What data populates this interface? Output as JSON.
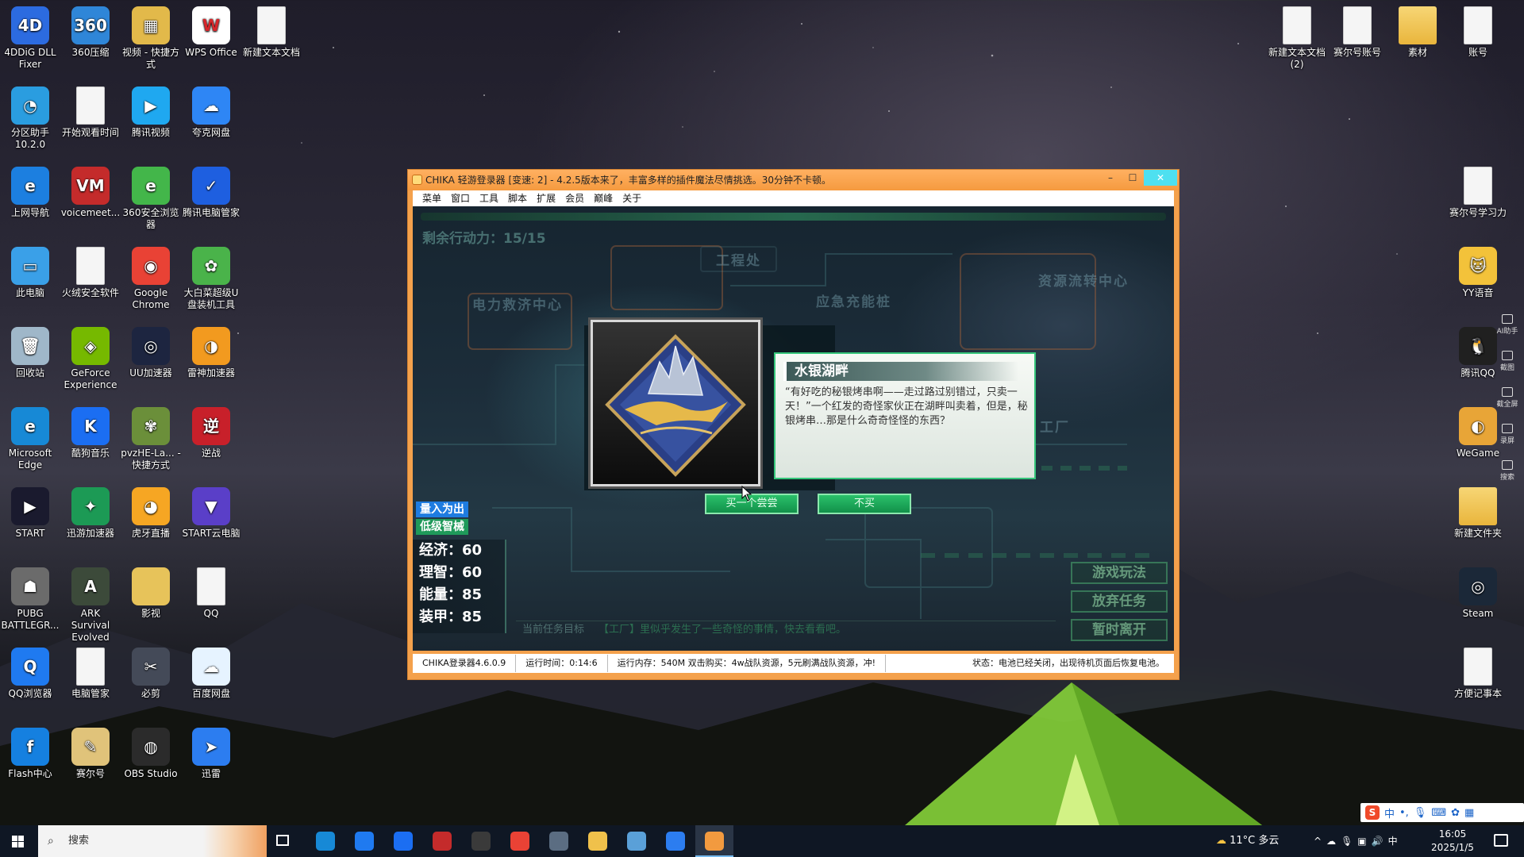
{
  "desktop": {
    "icons_left": [
      {
        "label": "4DDiG DLL Fixer",
        "color": "#2c6be0",
        "glyph": "4D"
      },
      {
        "label": "360压缩",
        "color": "#2f86d8",
        "glyph": "360"
      },
      {
        "label": "视频 - 快捷方式",
        "color": "#e2b94a",
        "glyph": "▦"
      },
      {
        "label": "WPS Office",
        "color": "#ffffff",
        "glyph": "W"
      },
      {
        "label": "新建文本文档",
        "color": "#f5f5f5",
        "glyph": ""
      },
      {
        "label": "分区助手 10.2.0",
        "color": "#2a9de0",
        "glyph": "◔"
      },
      {
        "label": "开始观看时间",
        "color": "#f5f5f5",
        "glyph": ""
      },
      {
        "label": "腾讯视频",
        "color": "#1fa8f0",
        "glyph": "▶"
      },
      {
        "label": "夸克网盘",
        "color": "#2e86f5",
        "glyph": "☁"
      },
      {
        "label": "上网导航",
        "color": "#1c7fe0",
        "glyph": "e"
      },
      {
        "label": "voicemeet...",
        "color": "#c42b2b",
        "glyph": "VM"
      },
      {
        "label": "360安全浏览器",
        "color": "#43b64a",
        "glyph": "e"
      },
      {
        "label": "腾讯电脑管家",
        "color": "#1e5fe0",
        "glyph": "✓"
      },
      {
        "label": "此电脑",
        "color": "#3aa0e8",
        "glyph": "▭"
      },
      {
        "label": "火绒安全软件",
        "color": "#f5f5f5",
        "glyph": ""
      },
      {
        "label": "Google Chrome",
        "color": "#e94235",
        "glyph": "◉"
      },
      {
        "label": "大白菜超级U盘装机工具",
        "color": "#4ab34a",
        "glyph": "✿"
      },
      {
        "label": "回收站",
        "color": "#9fb7c9",
        "glyph": "🗑"
      },
      {
        "label": "GeForce Experience",
        "color": "#76b900",
        "glyph": "◈"
      },
      {
        "label": "UU加速器",
        "color": "#1d2540",
        "glyph": "◎"
      },
      {
        "label": "雷神加速器",
        "color": "#f29a1f",
        "glyph": "◑"
      },
      {
        "label": "Microsoft Edge",
        "color": "#1789d6",
        "glyph": "e"
      },
      {
        "label": "酷狗音乐",
        "color": "#1b6ef2",
        "glyph": "K"
      },
      {
        "label": "pvzHE-La... - 快捷方式",
        "color": "#6b8f3a",
        "glyph": "✾"
      },
      {
        "label": "逆战",
        "color": "#c8202a",
        "glyph": "逆"
      },
      {
        "label": "START",
        "color": "#1a1a2e",
        "glyph": "▶"
      },
      {
        "label": "迅游加速器",
        "color": "#1c9a55",
        "glyph": "✦"
      },
      {
        "label": "虎牙直播",
        "color": "#f6a623",
        "glyph": "◕"
      },
      {
        "label": "START云电脑",
        "color": "#5a3fc8",
        "glyph": "▼"
      },
      {
        "label": "PUBG BATTLEGR...",
        "color": "#6b6b6b",
        "glyph": "☗"
      },
      {
        "label": "ARK Survival Evolved",
        "color": "#3c4a3a",
        "glyph": "A"
      },
      {
        "label": "影视",
        "color": "#e7c35a",
        "glyph": ""
      },
      {
        "label": "QQ",
        "color": "#f5f5f5",
        "glyph": "🐧"
      },
      {
        "label": "QQ浏览器",
        "color": "#1f7af0",
        "glyph": "Q"
      },
      {
        "label": "电脑管家",
        "color": "#f5f5f5",
        "glyph": ""
      },
      {
        "label": "必剪",
        "color": "#444a58",
        "glyph": "✂"
      },
      {
        "label": "百度网盘",
        "color": "#e6f3ff",
        "glyph": "☁"
      },
      {
        "label": "Flash中心",
        "color": "#1580e0",
        "glyph": "f"
      },
      {
        "label": "赛尔号",
        "color": "#e0c37a",
        "glyph": "✎"
      },
      {
        "label": "OBS Studio",
        "color": "#2b2b2b",
        "glyph": "◍"
      },
      {
        "label": "迅雷",
        "color": "#2c7df0",
        "glyph": "➤"
      }
    ],
    "icons_right": [
      {
        "label": "新建文本文档 (2)",
        "kind": "doc"
      },
      {
        "label": "赛尔号账号",
        "kind": "doc"
      },
      {
        "label": "素材",
        "kind": "folder"
      },
      {
        "label": "账号",
        "kind": "doc"
      },
      {
        "label": "赛尔号学习力",
        "kind": "doc"
      },
      {
        "label": "YY语音",
        "kind": "app",
        "color": "#f3c23a",
        "glyph": "🐱"
      },
      {
        "label": "腾讯QQ",
        "kind": "app",
        "color": "#202020",
        "glyph": "🐧"
      },
      {
        "label": "WeGame",
        "kind": "app",
        "color": "#e8a537",
        "glyph": "◐"
      },
      {
        "label": "新建文件夹",
        "kind": "folder"
      },
      {
        "label": "Steam",
        "kind": "app",
        "color": "#1b2838",
        "glyph": "◎"
      },
      {
        "label": "方便记事本",
        "kind": "doc"
      }
    ],
    "right_tools": [
      "AI助手",
      "截图",
      "截全屏",
      "录屏",
      "搜索"
    ]
  },
  "window": {
    "title": "CHIKA 轻游登录器 [变速: 2] - 4.2.5版本来了，丰富多样的插件魔法尽情挑选。30分钟不卡顿。",
    "controls": {
      "minimize": "–",
      "maximize": "☐",
      "close": "✕"
    },
    "menu": [
      "菜单",
      "窗口",
      "工具",
      "脚本",
      "扩展",
      "会员",
      "巅峰",
      "关于"
    ],
    "status": {
      "version": "CHIKA登录器4.6.0.9",
      "runtime": "运行时间：0:14:6",
      "memory": "运行内存：540M   双击购买：4w战队资源，5元刷满战队资源，冲!",
      "state": "状态：电池已经关闭，出现待机页面后恢复电池。"
    }
  },
  "game": {
    "action_points": "剩余行动力：15/15",
    "locations": [
      "工程处",
      "电力救济中心",
      "应急充能桩",
      "资源流转中心",
      "工厂"
    ],
    "dialog": {
      "title": "水银湖畔",
      "text": "“有好吃的秘银烤串啊——走过路过别错过，只卖一天！”一个红发的奇怪家伙正在湖畔叫卖着，但是，秘银烤串…那是什么奇奇怪怪的东西？"
    },
    "buttons": {
      "buy": "买一个尝尝",
      "decline": "不买"
    },
    "tags": [
      "量入为出",
      "低级智械"
    ],
    "stats": [
      {
        "label": "经济",
        "value": 60
      },
      {
        "label": "理智",
        "value": 60
      },
      {
        "label": "能量",
        "value": 85
      },
      {
        "label": "装甲",
        "value": 85
      }
    ],
    "side_buttons": [
      "游戏玩法",
      "放弃任务",
      "暂时离开"
    ],
    "task": {
      "label": "当前任务目标",
      "text": "【工厂】里似乎发生了一些奇怪的事情，快去看看吧。"
    }
  },
  "taskbar": {
    "search_placeholder": "搜索",
    "weather": "11°C 多云",
    "ime_lang": "中",
    "time": "16:05",
    "date": "2025/1/5",
    "apps": [
      {
        "name": "edge",
        "color": "#1789d6"
      },
      {
        "name": "qq-browser",
        "color": "#1f7af0"
      },
      {
        "name": "kugou",
        "color": "#1b6ef2"
      },
      {
        "name": "voicemeeter",
        "color": "#c42b2b"
      },
      {
        "name": "uu",
        "color": "#3a3a3a"
      },
      {
        "name": "chrome",
        "color": "#e94235"
      },
      {
        "name": "calculator",
        "color": "#5b6d82"
      },
      {
        "name": "explorer",
        "color": "#f0c14b"
      },
      {
        "name": "remote",
        "color": "#5aa0d8"
      },
      {
        "name": "xunlei",
        "color": "#2c7df0"
      },
      {
        "name": "chika",
        "color": "#f29a3f"
      }
    ]
  }
}
